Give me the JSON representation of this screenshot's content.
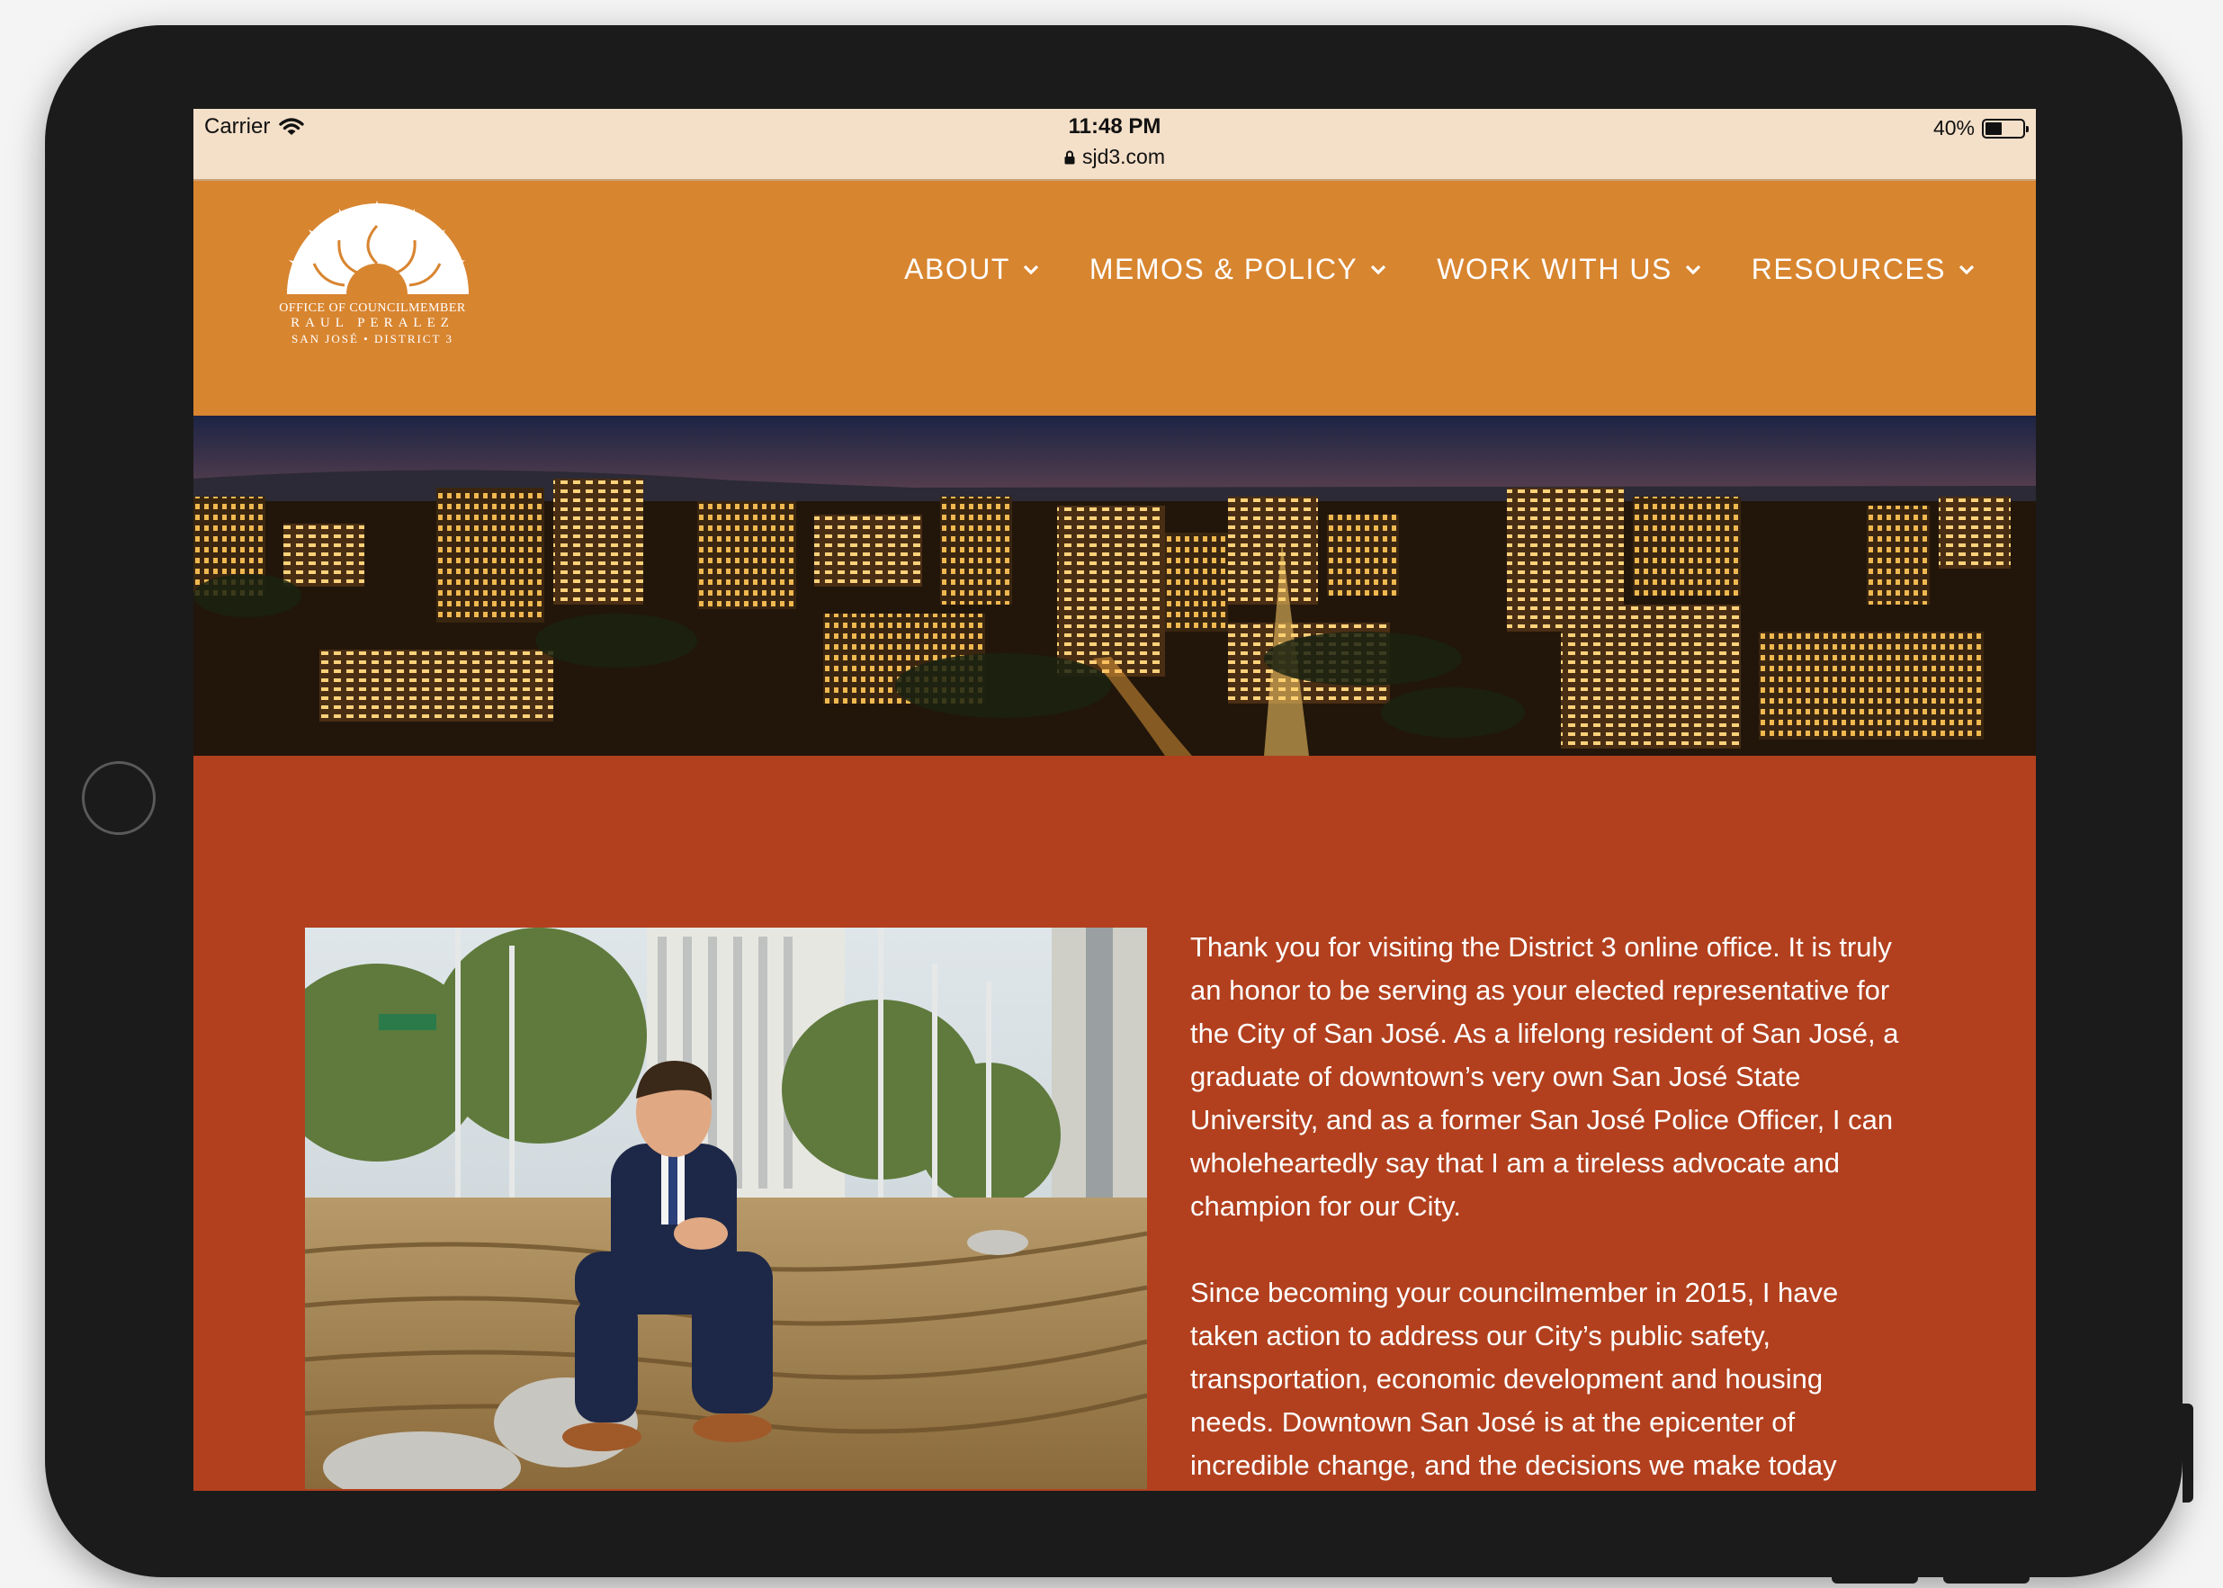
{
  "status_bar": {
    "carrier": "Carrier",
    "time": "11:48 PM",
    "url": "sjd3.com",
    "battery": "40%"
  },
  "logo": {
    "line1": "OFFICE OF COUNCILMEMBER",
    "line2": "RAUL PERALEZ",
    "line3": "SAN JOSÉ • DISTRICT 3"
  },
  "nav": {
    "items": [
      {
        "label": "ABOUT"
      },
      {
        "label": "MEMOS & POLICY"
      },
      {
        "label": "WORK WITH US"
      },
      {
        "label": "RESOURCES"
      }
    ]
  },
  "content": {
    "paragraph1": "Thank you for visiting the District 3 online office. It is truly an honor to be serving as your elected representative for the City of San José. As a lifelong resident of San José, a graduate of downtown’s very own San José State University, and as a former San José Police Officer, I can wholeheartedly say that I am a tireless advocate and champion for our City.",
    "paragraph2": "Since becoming your councilmember in 2015, I have taken action to address our City’s public safety, transportation, economic development and housing needs. Downtown San José is at the epicenter of incredible change, and the decisions we make today"
  },
  "colors": {
    "header_bg": "#d88530",
    "body_bg": "#b2401e",
    "status_bg": "#f4dfc8",
    "bezel": "#1b1b1b"
  },
  "icons": [
    "wifi-icon",
    "lock-icon",
    "battery-icon",
    "chevron-down-icon",
    "sun-logo-icon"
  ]
}
